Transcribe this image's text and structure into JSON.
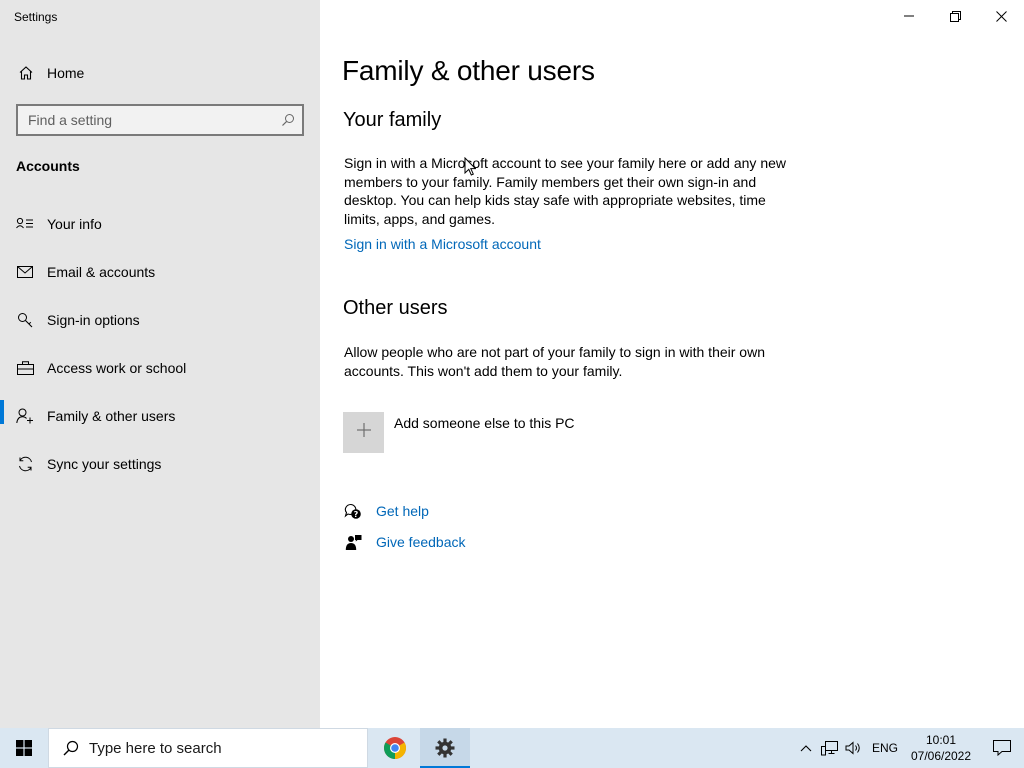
{
  "window": {
    "app_title": "Settings"
  },
  "sidebar": {
    "home_label": "Home",
    "search_placeholder": "Find a setting",
    "section_title": "Accounts",
    "items": [
      {
        "label": "Your info",
        "icon": "contact-card-icon"
      },
      {
        "label": "Email & accounts",
        "icon": "mail-icon"
      },
      {
        "label": "Sign-in options",
        "icon": "key-icon"
      },
      {
        "label": "Access work or school",
        "icon": "briefcase-icon"
      },
      {
        "label": "Family & other users",
        "icon": "add-person-icon",
        "active": true
      },
      {
        "label": "Sync your settings",
        "icon": "sync-icon"
      }
    ]
  },
  "main": {
    "title": "Family & other users",
    "your_family": {
      "heading": "Your family",
      "description": "Sign in with a Microsoft account to see your family here or add any new members to your family. Family members get their own sign-in and desktop. You can help kids stay safe with appropriate websites, time limits, apps, and games.",
      "link": "Sign in with a Microsoft account"
    },
    "other_users": {
      "heading": "Other users",
      "description": "Allow people who are not part of your family to sign in with their own accounts. This won't add them to your family.",
      "add_label": "Add someone else to this PC"
    },
    "help": {
      "get_help": "Get help",
      "give_feedback": "Give feedback"
    }
  },
  "taskbar": {
    "search_placeholder": "Type here to search",
    "language": "ENG",
    "time": "10:01",
    "date": "07/06/2022"
  },
  "colors": {
    "accent": "#0078d7",
    "link": "#0067b8",
    "sidebar_bg": "#e6e6e6",
    "taskbar_bg": "#dae7f2"
  }
}
